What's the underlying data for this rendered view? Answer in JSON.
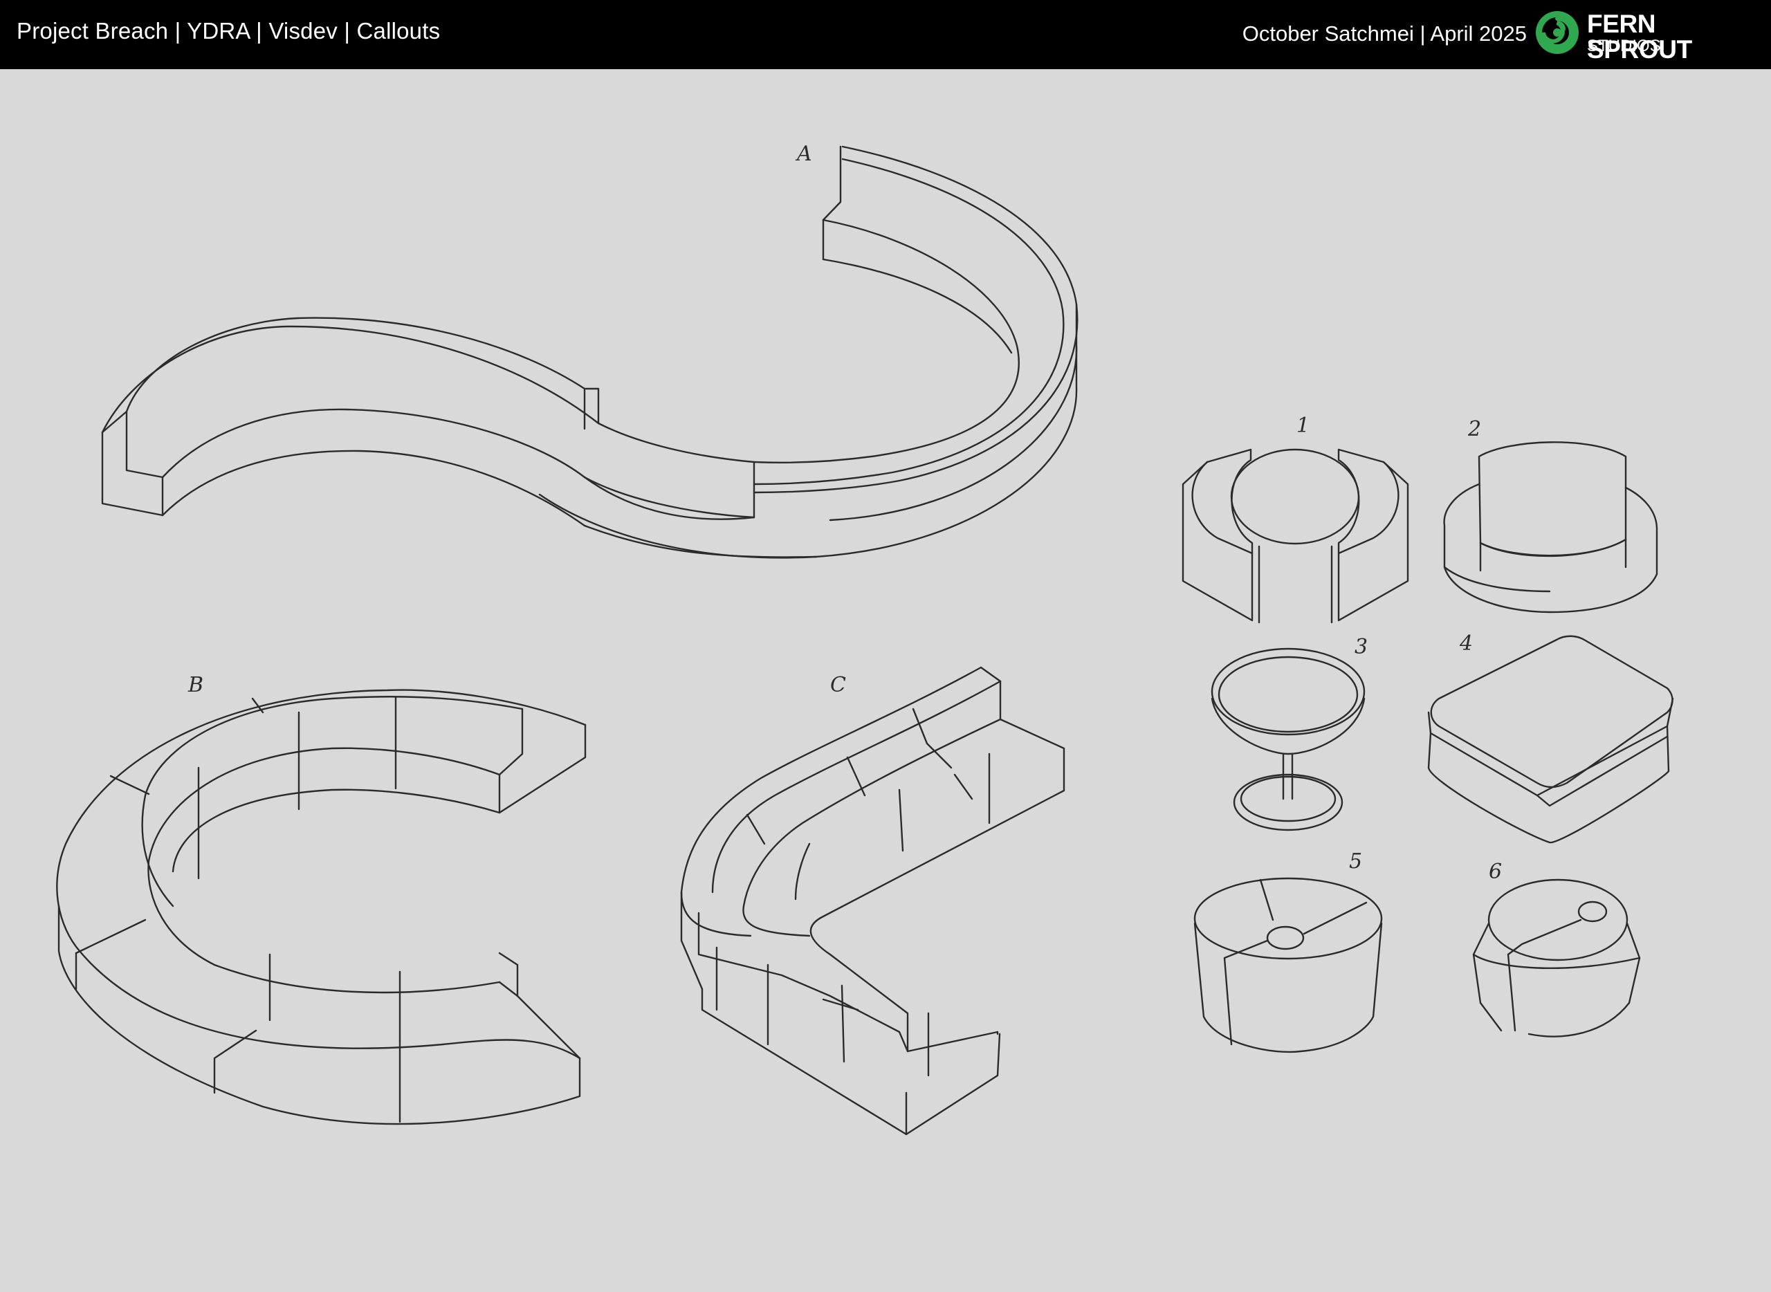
{
  "header": {
    "title": "Project Breach | YDRA | Visdev | Callouts",
    "meta": "October Satchmei | April 2025",
    "brand_name": "FERN SPROUT",
    "brand_sub": "STUDIOS"
  },
  "colors": {
    "header_bg": "#000000",
    "canvas_bg": "#d9d9d9",
    "sketch_line": "#2b2b2b",
    "logo_green": "#2fa84f"
  },
  "icons": {
    "logo": "fern-spiral-icon"
  },
  "labels": {
    "a": "A",
    "b": "B",
    "c": "C",
    "n1": "1",
    "n2": "2",
    "n3": "3",
    "n4": "4",
    "n5": "5",
    "n6": "6"
  }
}
